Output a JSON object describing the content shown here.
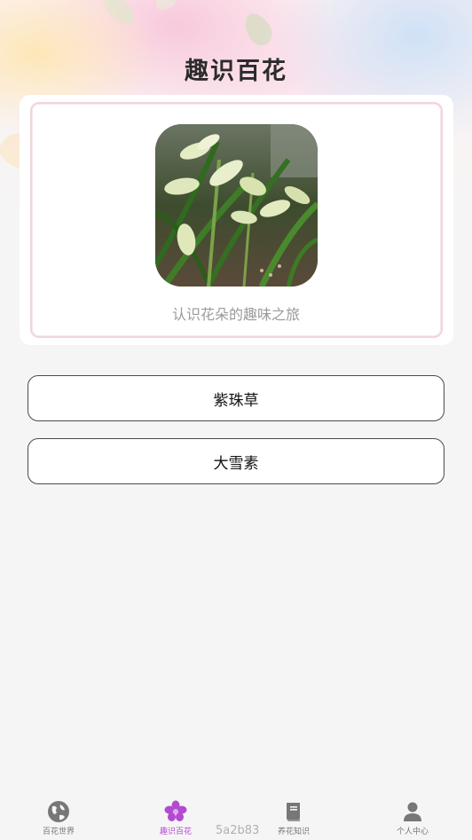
{
  "header": {
    "title": "趣识百花"
  },
  "card": {
    "caption": "认识花朵的趣味之旅",
    "image_subject": "orchid-flower-photo"
  },
  "flowers": [
    {
      "label": "紫珠草"
    },
    {
      "label": "大雪素"
    }
  ],
  "bottom_nav": {
    "items": [
      {
        "label": "百花世界",
        "icon": "globe-icon",
        "active": false
      },
      {
        "label": "趣识百花",
        "icon": "flower-icon",
        "active": true
      },
      {
        "label": "养花知识",
        "icon": "book-icon",
        "active": false
      },
      {
        "label": "个人中心",
        "icon": "person-icon",
        "active": false
      }
    ],
    "code_text": "5a2b83"
  },
  "colors": {
    "active": "#b24bd0",
    "inactive": "#777777",
    "card_border": "#efd6de"
  }
}
